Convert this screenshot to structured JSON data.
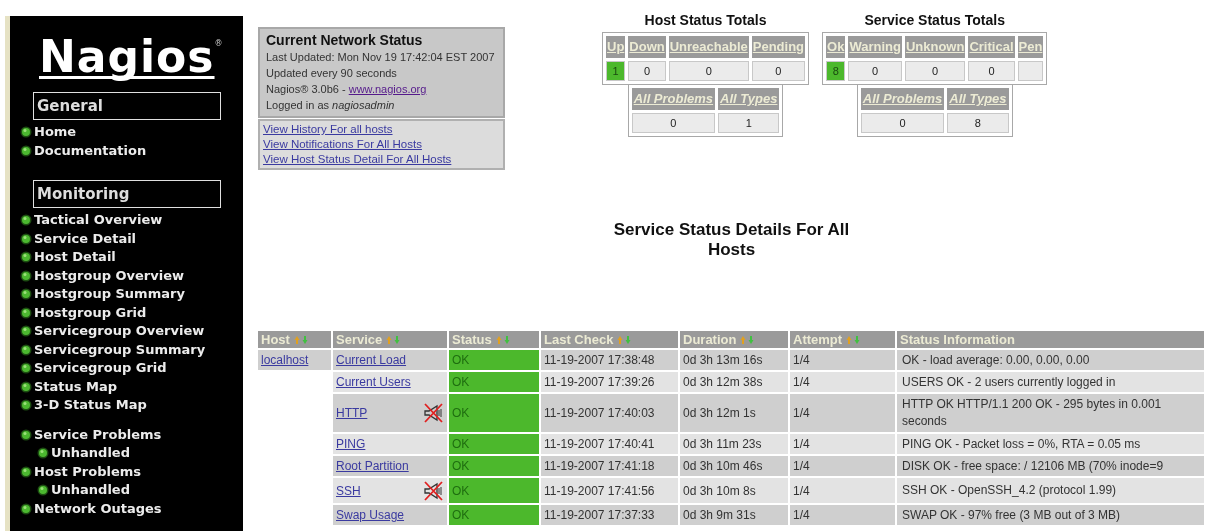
{
  "sidebar": {
    "logo": "Nagios",
    "logo_mark": "®",
    "sections": [
      {
        "title": "General",
        "groups": [
          [
            {
              "label": "Home"
            },
            {
              "label": "Documentation"
            }
          ]
        ]
      },
      {
        "title": "Monitoring",
        "groups": [
          [
            {
              "label": "Tactical Overview"
            },
            {
              "label": "Service Detail"
            },
            {
              "label": "Host Detail"
            },
            {
              "label": "Hostgroup Overview"
            },
            {
              "label": "Hostgroup Summary"
            },
            {
              "label": "Hostgroup Grid"
            },
            {
              "label": "Servicegroup Overview"
            },
            {
              "label": "Servicegroup Summary"
            },
            {
              "label": "Servicegroup Grid"
            },
            {
              "label": "Status Map"
            },
            {
              "label": "3-D Status Map"
            }
          ],
          [
            {
              "label": "Service Problems",
              "children": [
                {
                  "label": "Unhandled"
                }
              ]
            },
            {
              "label": "Host Problems",
              "children": [
                {
                  "label": "Unhandled"
                }
              ]
            },
            {
              "label": "Network Outages"
            }
          ]
        ]
      }
    ]
  },
  "status_box": {
    "title": "Current Network Status",
    "last_updated": "Last Updated: Mon Nov 19 17:42:04 EST 2007",
    "interval": "Updated every 90 seconds",
    "version": "Nagios® 3.0b6 - ",
    "link": "www.nagios.org",
    "login": "Logged in as *nagiosadmin*"
  },
  "links": [
    "View History For all hosts",
    "View Notifications For All Hosts",
    "View Host Status Detail For All Hosts"
  ],
  "totals": [
    {
      "title": "Host Status Totals",
      "columns": [
        {
          "label": "Up",
          "value": "1",
          "highlight": true
        },
        {
          "label": "Down",
          "value": "0",
          "highlight": false
        },
        {
          "label": "Unreachable",
          "value": "0",
          "highlight": false
        },
        {
          "label": "Pending",
          "value": "0",
          "highlight": false
        }
      ],
      "summary": [
        {
          "label": "All Problems",
          "value": "0"
        },
        {
          "label": "All Types",
          "value": "1"
        }
      ]
    },
    {
      "title": "Service Status Totals",
      "columns": [
        {
          "label": "Ok",
          "value": "8",
          "highlight": true
        },
        {
          "label": "Warning",
          "value": "0",
          "highlight": false
        },
        {
          "label": "Unknown",
          "value": "0",
          "highlight": false
        },
        {
          "label": "Critical",
          "value": "0",
          "highlight": false
        },
        {
          "label": "Pen",
          "highlight": false
        }
      ],
      "summary": [
        {
          "label": "All Problems",
          "value": "0"
        },
        {
          "label": "All Types",
          "value": "8"
        }
      ]
    }
  ],
  "page_title": "Service Status Details For All Hosts",
  "table": {
    "columns": [
      {
        "label": "Host",
        "sortable": true
      },
      {
        "label": "Service",
        "sortable": true
      },
      {
        "label": "Status",
        "sortable": true
      },
      {
        "label": "Last Check",
        "sortable": true
      },
      {
        "label": "Duration",
        "sortable": true
      },
      {
        "label": "Attempt",
        "sortable": true
      },
      {
        "label": "Status Information",
        "sortable": false
      }
    ],
    "rows": [
      {
        "host": "localhost",
        "service": "Current Load",
        "notifications_disabled": false,
        "status": "OK",
        "last_check": "11-19-2007 17:38:48",
        "duration": "0d 3h 13m 16s",
        "attempt": "1/4",
        "info": "OK - load average: 0.00, 0.00, 0.00"
      },
      {
        "service": "Current Users",
        "notifications_disabled": false,
        "status": "OK",
        "last_check": "11-19-2007 17:39:26",
        "duration": "0d 3h 12m 38s",
        "attempt": "1/4",
        "info": "USERS OK - 2 users currently logged in"
      },
      {
        "service": "HTTP",
        "notifications_disabled": true,
        "status": "OK",
        "last_check": "11-19-2007 17:40:03",
        "duration": "0d 3h 12m 1s",
        "attempt": "1/4",
        "info": "HTTP OK HTTP/1.1 200 OK - 295 bytes in 0.001 seconds"
      },
      {
        "service": "PING",
        "notifications_disabled": false,
        "status": "OK",
        "last_check": "11-19-2007 17:40:41",
        "duration": "0d 3h 11m 23s",
        "attempt": "1/4",
        "info": "PING OK - Packet loss = 0%, RTA = 0.05 ms"
      },
      {
        "service": "Root Partition",
        "notifications_disabled": false,
        "status": "OK",
        "last_check": "11-19-2007 17:41:18",
        "duration": "0d 3h 10m 46s",
        "attempt": "1/4",
        "info": "DISK OK - free space: / 12106 MB (70% inode=9"
      },
      {
        "service": "SSH",
        "notifications_disabled": true,
        "status": "OK",
        "last_check": "11-19-2007 17:41:56",
        "duration": "0d 3h 10m 8s",
        "attempt": "1/4",
        "info": "SSH OK - OpenSSH_4.2 (protocol 1.99)"
      },
      {
        "service": "Swap Usage",
        "notifications_disabled": false,
        "status": "OK",
        "last_check": "11-19-2007 17:37:33",
        "duration": "0d 3h 9m 31s",
        "attempt": "1/4",
        "info": "SWAP OK - 97% free (3 MB out of 3 MB)"
      }
    ]
  }
}
